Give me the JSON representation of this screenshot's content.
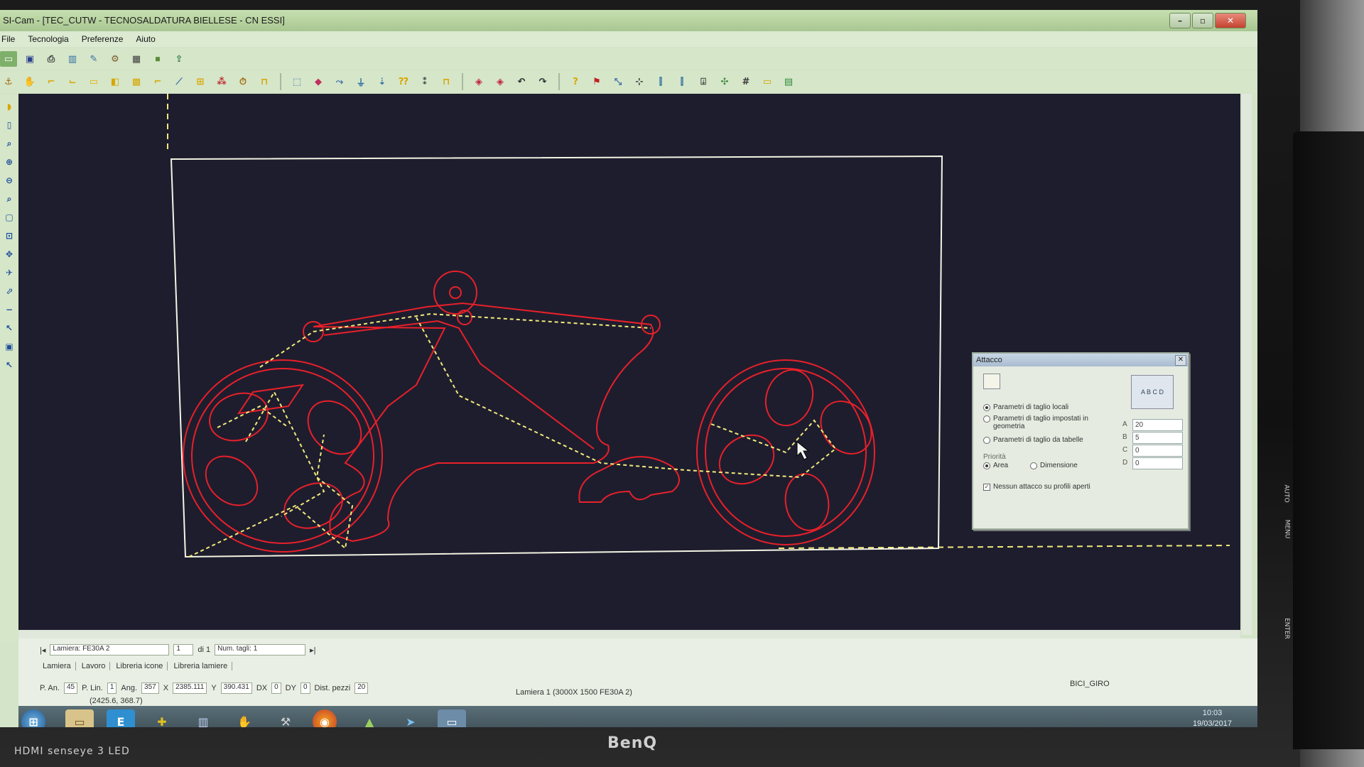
{
  "window": {
    "title": "SI-Cam - [TEC_CUTW - TECNOSALDATURA BIELLESE - CN ESSI]"
  },
  "menu": [
    "File",
    "Tecnologia",
    "Preferenze",
    "Aiuto"
  ],
  "status": {
    "lamiera": "Lamiera: FE30A 2",
    "page": "1",
    "of": "di 1",
    "num_tagli": "Num. tagli: 1",
    "tabs": [
      "Lamiera",
      "Lavoro",
      "Libreria icone",
      "Libreria lamiere"
    ],
    "p_an_label": "P. An.",
    "p_an": "45",
    "p_lin_label": "P. Lin.",
    "p_lin": "1",
    "ang_label": "Ang.",
    "ang": "357",
    "x_label": "X",
    "x": "2385.111",
    "y_label": "Y",
    "y": "390.431",
    "dx_label": "DX",
    "dx": "0",
    "dy_label": "DY",
    "dy": "0",
    "dist_pezzi_label": "Dist. pezzi",
    "dist_pezzi": "20",
    "coords": "(2425.6, 368.7)",
    "sheet_info": "Lamiera 1 (3000X 1500 FE30A 2)",
    "file": "BICI_GIRO"
  },
  "dialog": {
    "title": "Attacco",
    "options": [
      {
        "label": "Parametri di taglio locali",
        "selected": true
      },
      {
        "label": "Parametri di taglio impostati in geometria",
        "selected": false
      },
      {
        "label": "Parametri di taglio da tabelle",
        "selected": false
      }
    ],
    "priority_label": "Priorità",
    "priority": [
      {
        "label": "Area",
        "selected": true
      },
      {
        "label": "Dimensione",
        "selected": false
      }
    ],
    "checkbox_label": "Nessun attacco su profili aperti",
    "checkbox_checked": true,
    "params": [
      {
        "label": "A",
        "value": "20"
      },
      {
        "label": "B",
        "value": "5"
      },
      {
        "label": "C",
        "value": "0"
      },
      {
        "label": "D",
        "value": "0"
      }
    ],
    "diagram_text": "A B C D"
  },
  "taskbar": {
    "time": "10:03",
    "date": "19/03/2017"
  },
  "monitor": {
    "brand": "BenQ",
    "features": "HDMI senseye 3 LED",
    "side_labels": [
      "AUTO",
      "MENU",
      "ENTER"
    ]
  },
  "colors": {
    "canvas": "#1e1d2e",
    "profile": "#e8202a",
    "path": "#f2ea7a",
    "sheet_border": "#f4f4e4"
  }
}
